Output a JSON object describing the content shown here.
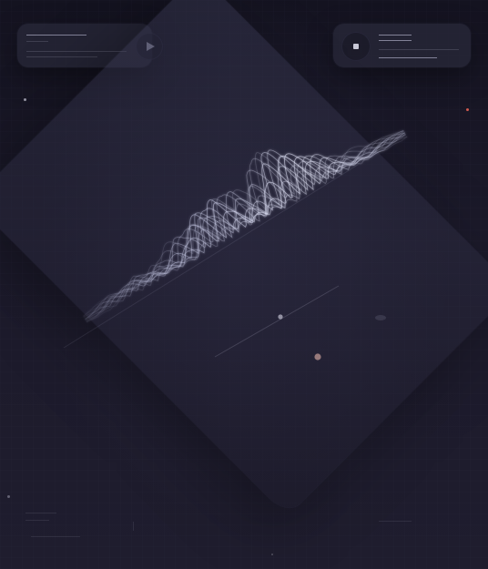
{
  "colors": {
    "background": "#1a1826",
    "panel": "#2a2a38",
    "accent": "#cfd2ee",
    "muted": "#8d8fb0",
    "dot_warm": "#d6a9a2",
    "dot_red": "#ff6b5a"
  },
  "controls": {
    "left_card": {
      "icon": "play-icon"
    },
    "right_card": {
      "icon": "stop-icon"
    }
  },
  "wave": {
    "amplitudes": [
      0.04,
      0.06,
      0.1,
      0.14,
      0.12,
      0.18,
      0.26,
      0.22,
      0.3,
      0.24,
      0.34,
      0.42,
      0.36,
      0.5,
      0.62,
      0.58,
      0.74,
      0.66,
      0.78,
      0.7,
      0.84,
      0.8,
      0.92,
      0.86,
      0.74,
      0.6,
      0.52,
      0.46,
      0.34,
      0.28,
      0.2,
      0.16,
      0.12,
      0.1,
      0.08,
      0.06
    ]
  },
  "decor": {
    "stars": [
      "star-1",
      "star-2",
      "star-3",
      "star-4"
    ]
  }
}
